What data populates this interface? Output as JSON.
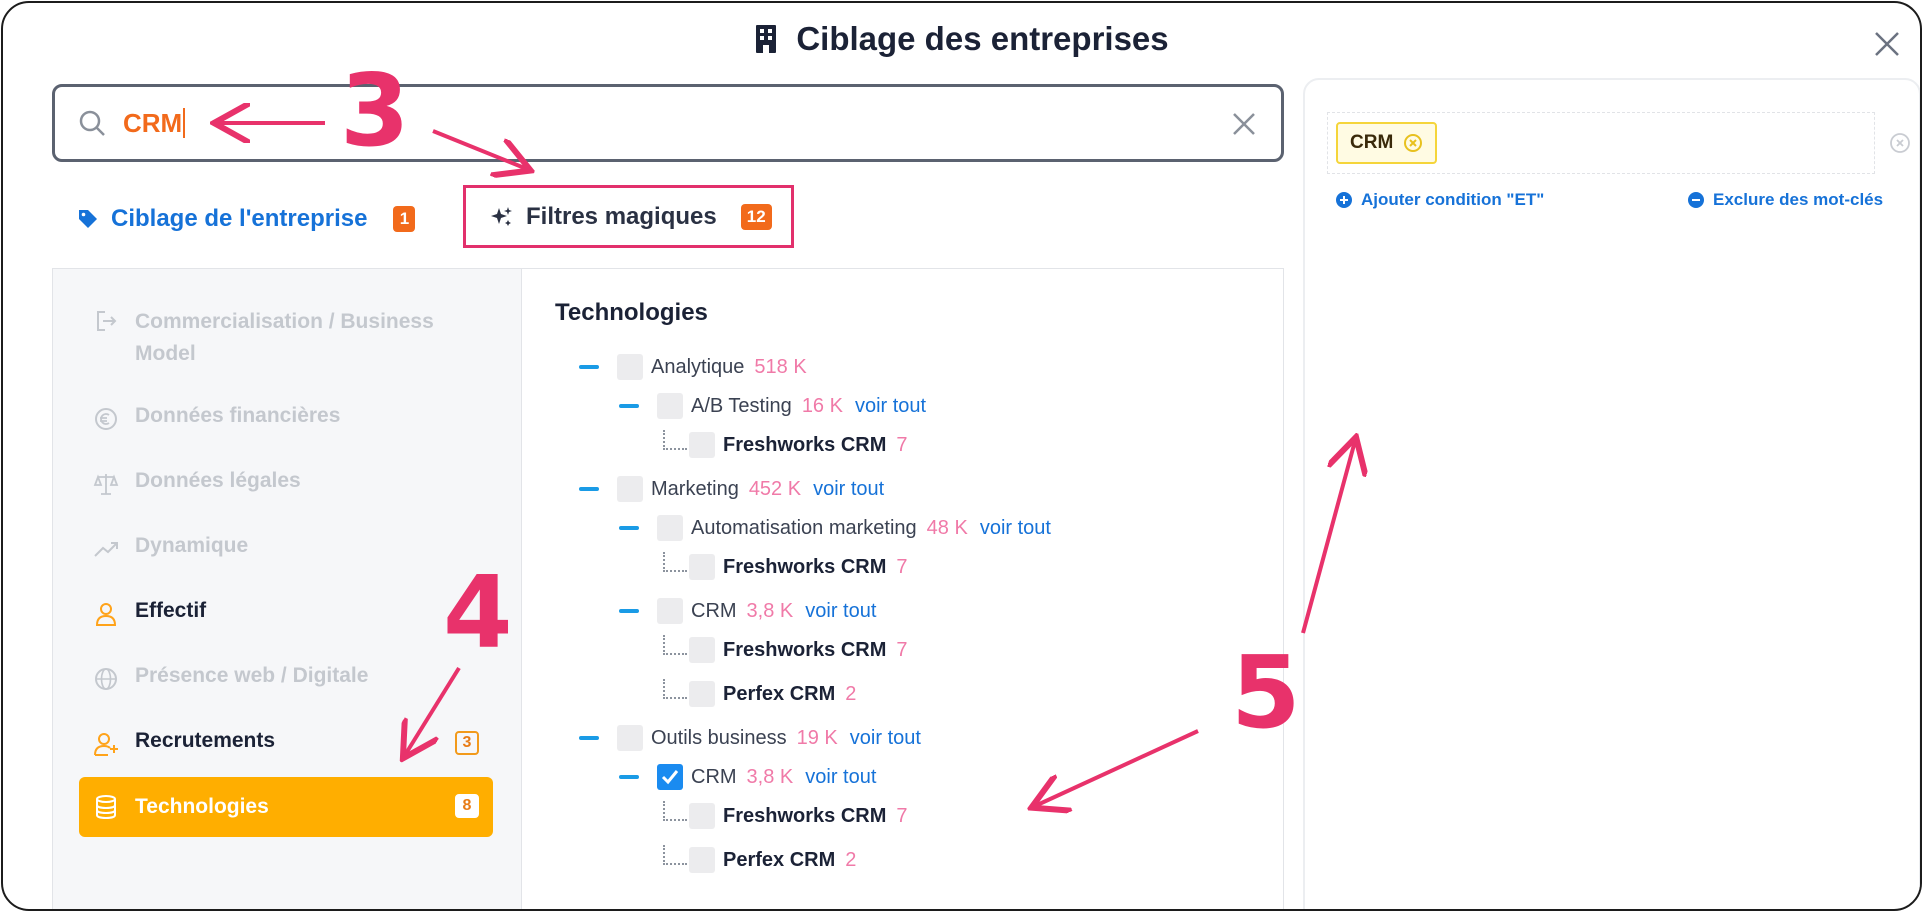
{
  "modal": {
    "title": "Ciblage des entreprises",
    "icon": "building-icon",
    "close_icon": "close-icon"
  },
  "search": {
    "value": "CRM",
    "icon": "search-icon",
    "clear_icon": "clear-icon"
  },
  "tabs": [
    {
      "label": "Ciblage de l'entreprise",
      "badge": "1",
      "icon": "tag-icon"
    },
    {
      "label": "Filtres magiques",
      "badge": "12",
      "icon": "sparkles-icon"
    }
  ],
  "sidebar": {
    "items": [
      {
        "label": "Commercialisation / Business",
        "label2": "Model",
        "icon": "exit-icon",
        "state": "muted"
      },
      {
        "label": "Données financières",
        "icon": "euro-icon",
        "state": "muted"
      },
      {
        "label": "Données légales",
        "icon": "scale-icon",
        "state": "muted"
      },
      {
        "label": "Dynamique",
        "icon": "trend-icon",
        "state": "muted"
      },
      {
        "label": "Effectif",
        "icon": "user-icon",
        "state": "normal"
      },
      {
        "label": "Présence web / Digitale",
        "icon": "globe-icon",
        "state": "muted"
      },
      {
        "label": "Recrutements",
        "icon": "user-plus-icon",
        "state": "normal",
        "count": "3"
      },
      {
        "label": "Technologies",
        "icon": "database-icon",
        "state": "active",
        "count": "8"
      }
    ]
  },
  "content": {
    "heading": "Technologies",
    "view_all": "voir tout",
    "tree": {
      "analytique": {
        "label": "Analytique",
        "count": "518 K"
      },
      "ab_testing": {
        "label": "A/B Testing",
        "count": "16 K"
      },
      "marketing": {
        "label": "Marketing",
        "count": "452 K"
      },
      "automatisation": {
        "label": "Automatisation marketing",
        "count": "48 K"
      },
      "crm": {
        "label": "CRM",
        "count": "3,8 K"
      },
      "outils": {
        "label": "Outils business",
        "count": "19 K"
      },
      "freshworks": {
        "label": "Freshworks CRM",
        "count": "7"
      },
      "perfex": {
        "label": "Perfex CRM",
        "count": "2"
      }
    }
  },
  "right_panel": {
    "chip": "CRM",
    "add_condition": "Ajouter condition \"ET\"",
    "exclude_keywords": "Exclure des mot-clés"
  },
  "annotations": {
    "n3": "3",
    "n4": "4",
    "n5": "5"
  },
  "colors": {
    "accent": "#1672d8",
    "orange": "#f26a1b",
    "active": "#ffae00",
    "annotation": "#e8326b",
    "count_pink": "#f07aa8"
  }
}
